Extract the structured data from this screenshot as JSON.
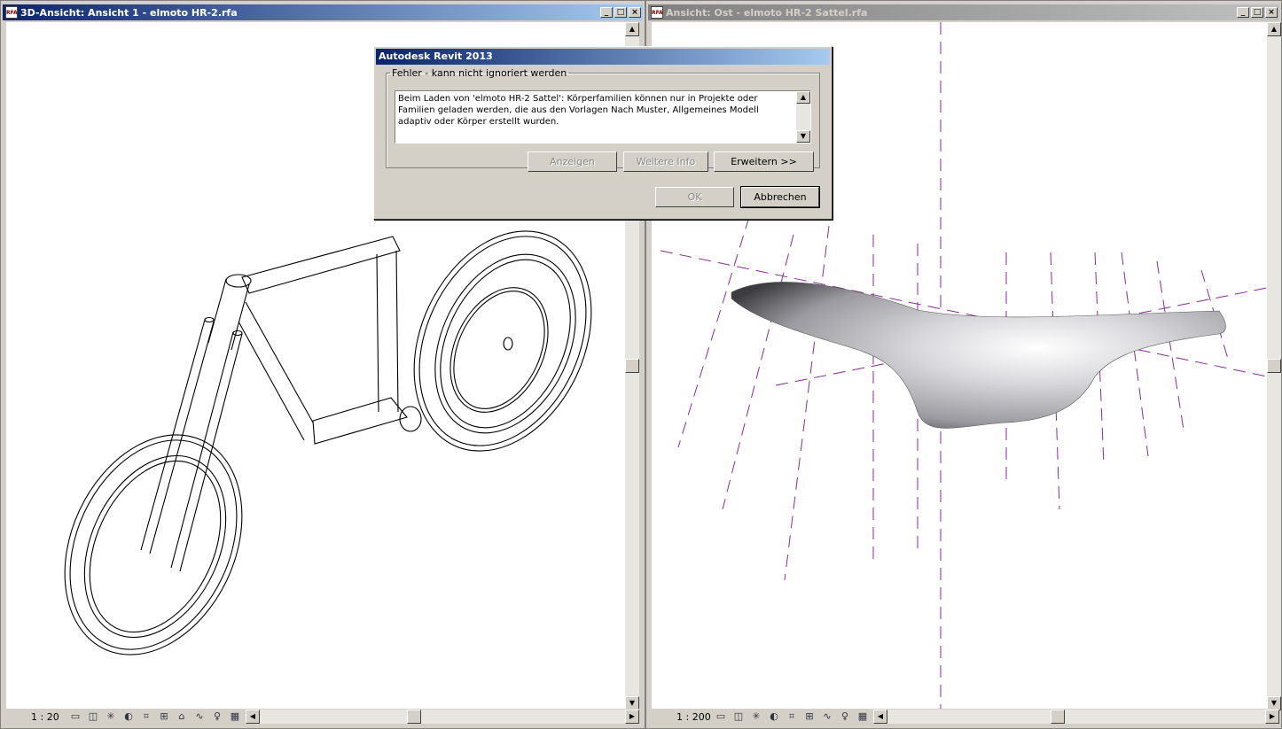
{
  "left_window": {
    "title": "3D-Ansicht: Ansicht 1 - elmoto HR-2.rfa",
    "icon_label": "RFA",
    "scale": "1 : 20",
    "state": "active"
  },
  "right_window": {
    "title": "Ansicht: Ost - elmoto HR-2 Sattel.rfa",
    "icon_label": "RFA",
    "scale": "1 : 200",
    "state": "inactive"
  },
  "window_buttons": {
    "minimize": "_",
    "maximize": "□",
    "close": "×"
  },
  "dialog": {
    "title": "Autodesk Revit 2013",
    "group_label": "Fehler - kann nicht ignoriert werden",
    "message": "Beim Laden von 'elmoto HR-2 Sattel': Körperfamilien können nur in Projekte oder Familien geladen werden, die aus den Vorlagen Nach Muster, Allgemeines Modell adaptiv oder Körper erstellt wurden.",
    "buttons": {
      "show": "Anzeigen",
      "more_info": "Weitere Info",
      "expand": "Erweitern >>",
      "ok": "OK",
      "cancel": "Abbrechen"
    }
  },
  "view_control_icons": [
    "detail-level-icon",
    "visual-style-icon",
    "sun-path-icon",
    "shadows-icon",
    "crop-view-icon",
    "show-crop-icon",
    "lock-3d-icon",
    "temporary-hide-icon",
    "reveal-hidden-icon",
    "analytical-icon",
    "constraints-icon"
  ]
}
